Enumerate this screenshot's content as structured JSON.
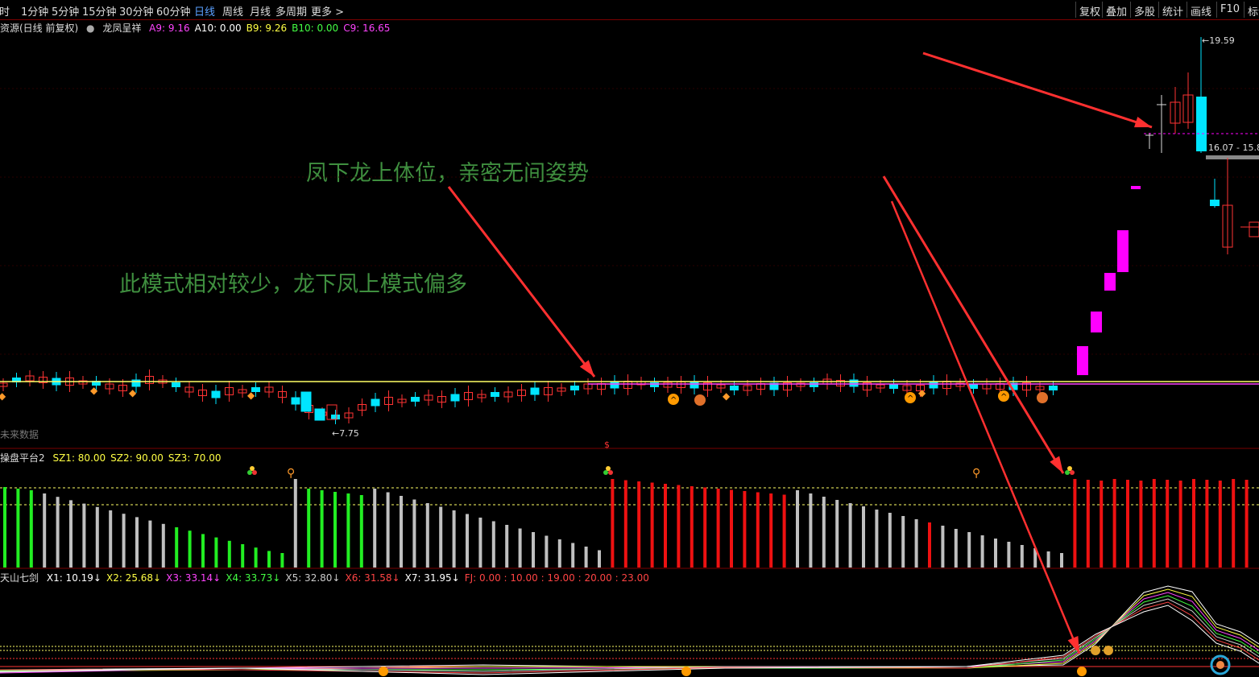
{
  "toolbar": {
    "left": [
      "分时",
      "1分钟",
      "5分钟",
      "15分钟",
      "30分钟",
      "60分钟",
      "日线",
      "周线",
      "月线",
      "多周期",
      "更多"
    ],
    "active": "日线",
    "more_arrow": ">",
    "right": [
      "复权",
      "叠加",
      "多股",
      "统计",
      "画线",
      "F10",
      "标记"
    ]
  },
  "main_panel": {
    "title": "资源(日线 前复权)",
    "indicator": "龙凤呈祥",
    "values": [
      {
        "label": "A9: 9.16",
        "color": "#ff44ff"
      },
      {
        "label": "A10: 0.00",
        "color": "#ffffff"
      },
      {
        "label": "B9: 9.26",
        "color": "#ffff44"
      },
      {
        "label": "B10: 0.00",
        "color": "#44ff44"
      },
      {
        "label": "C9: 16.65",
        "color": "#ff44ff"
      }
    ],
    "high_label": "19.59",
    "low_label": "7.75",
    "price_range_label": "16.07 - 15.8",
    "future_label": "未来数据"
  },
  "annotations": {
    "note1": "凤下龙上体位，亲密无间姿势",
    "note2": "此模式相对较少，龙下凤上模式偏多"
  },
  "panel2": {
    "title": "操盘平台2",
    "values": [
      {
        "label": "SZ1: 80.00",
        "color": "#ffff44"
      },
      {
        "label": "SZ2: 90.00",
        "color": "#ffff44"
      },
      {
        "label": "SZ3: 70.00",
        "color": "#ffff44"
      }
    ],
    "marker": "$"
  },
  "panel3": {
    "title": "天山七剑",
    "values": [
      {
        "label": "X1: 10.19↓",
        "color": "#ffffff"
      },
      {
        "label": "X2: 25.68↓",
        "color": "#ffff44"
      },
      {
        "label": "X3: 33.14↓",
        "color": "#ff44ff"
      },
      {
        "label": "X4: 33.73↓",
        "color": "#44ff44"
      },
      {
        "label": "X5: 32.80↓",
        "color": "#cccccc"
      },
      {
        "label": "X6: 31.58↓",
        "color": "#ff4444"
      },
      {
        "label": "X7: 31.95↓",
        "color": "#ffffff"
      },
      {
        "label": "FJ: 0.00 : 10.00 : 19.00 : 20.00 : 23.00",
        "color": "#ff4444"
      }
    ]
  },
  "colors": {
    "up": "#ff3333",
    "down": "#00e5ff",
    "special": "#ff00ff",
    "line_yellow": "#ffff66",
    "line_magenta": "#ff44ff",
    "bar_green": "#22ee22",
    "bar_gray": "#c0c0c0",
    "bar_red": "#ee1111",
    "arrow": "#ff3030",
    "note": "#3f8f3f"
  }
}
